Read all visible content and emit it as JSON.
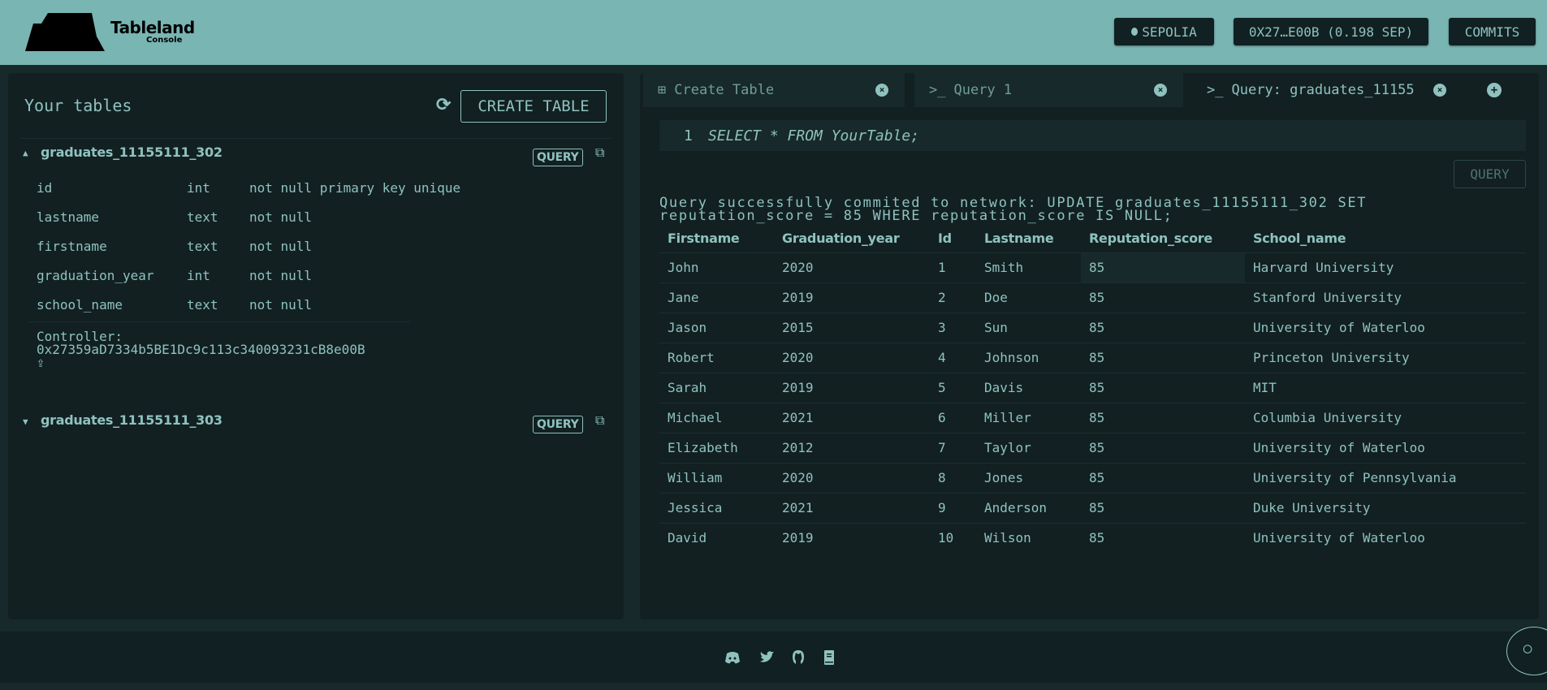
{
  "header": {
    "logo_title": "Tableland",
    "logo_subtitle": "Console",
    "network_label": "SEPOLIA",
    "wallet_label": "0X27…E00B (0.198 SEP)",
    "commits_label": "COMMITS"
  },
  "sidebar": {
    "title": "Your tables",
    "create_table_label": "CREATE TABLE",
    "tables": [
      {
        "name": "graduates_11155111_302",
        "expanded": true,
        "query_label": "QUERY",
        "columns": [
          {
            "name": "id",
            "type": "int",
            "constraints": "not null primary key unique"
          },
          {
            "name": "lastname",
            "type": "text",
            "constraints": "not null"
          },
          {
            "name": "firstname",
            "type": "text",
            "constraints": "not null"
          },
          {
            "name": "graduation_year",
            "type": "int",
            "constraints": "not null"
          },
          {
            "name": "school_name",
            "type": "text",
            "constraints": "not null"
          }
        ],
        "controller_label": "Controller:",
        "controller": "0x27359aD7334b5BE1Dc9c113c340093231cB8e00B"
      },
      {
        "name": "graduates_11155111_303",
        "expanded": false,
        "query_label": "QUERY"
      }
    ]
  },
  "tabs": [
    {
      "label": "Create Table",
      "icon": "plus-square-icon"
    },
    {
      "label": "Query 1",
      "icon": "terminal-icon"
    },
    {
      "label": "Query: graduates_11155",
      "icon": "terminal-icon",
      "active": true
    }
  ],
  "editor": {
    "line_number": "1",
    "code": "SELECT * FROM YourTable;",
    "query_label": "QUERY"
  },
  "message": "Query successfully commited to network: UPDATE graduates_11155111_302 SET reputation_score = 85 WHERE reputation_score IS NULL;",
  "results": {
    "columns": [
      "Firstname",
      "Graduation_year",
      "Id",
      "Lastname",
      "Reputation_score",
      "School_name"
    ],
    "rows": [
      [
        "John",
        "2020",
        "1",
        "Smith",
        "85",
        "Harvard University"
      ],
      [
        "Jane",
        "2019",
        "2",
        "Doe",
        "85",
        "Stanford University"
      ],
      [
        "Jason",
        "2015",
        "3",
        "Sun",
        "85",
        "University of Waterloo"
      ],
      [
        "Robert",
        "2020",
        "4",
        "Johnson",
        "85",
        "Princeton University"
      ],
      [
        "Sarah",
        "2019",
        "5",
        "Davis",
        "85",
        "MIT"
      ],
      [
        "Michael",
        "2021",
        "6",
        "Miller",
        "85",
        "Columbia University"
      ],
      [
        "Elizabeth",
        "2012",
        "7",
        "Taylor",
        "85",
        "University of Waterloo"
      ],
      [
        "William",
        "2020",
        "8",
        "Jones",
        "85",
        "University of Pennsylvania"
      ],
      [
        "Jessica",
        "2021",
        "9",
        "Anderson",
        "85",
        "Duke University"
      ],
      [
        "David",
        "2019",
        "10",
        "Wilson",
        "85",
        "University of Waterloo"
      ]
    ]
  },
  "footer": {
    "icons": [
      "discord-icon",
      "twitter-icon",
      "github-icon",
      "docs-icon"
    ]
  },
  "colors": {
    "header": "#78b5b3",
    "background": "#17292a",
    "panel": "#122022",
    "text": "#8fc2be"
  }
}
